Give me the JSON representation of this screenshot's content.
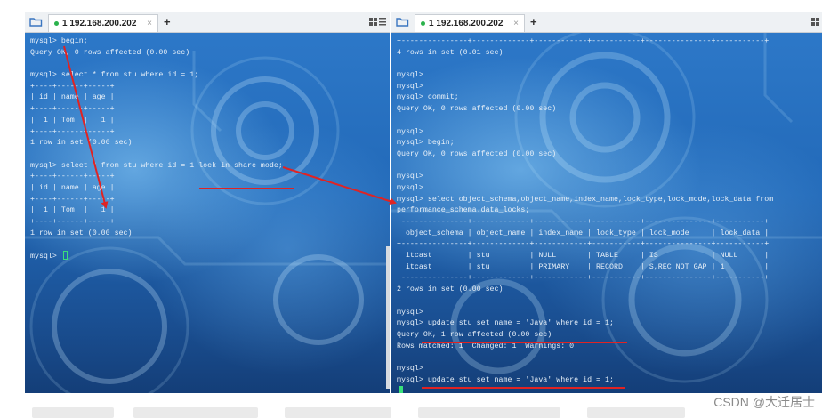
{
  "left": {
    "tab": {
      "label": "1 192.168.200.202",
      "close": "×",
      "add": "+"
    },
    "lines": [
      "mysql> begin;",
      "Query OK, 0 rows affected (0.00 sec)",
      "",
      "mysql> select * from stu where id = 1;",
      "+----+------+-----+",
      "| id | name | age |",
      "+----+------+-----+",
      "|  1 | Tom  |   1 |",
      "+----+------+-----+",
      "1 row in set (0.00 sec)",
      "",
      "mysql> select * from stu where id = 1 lock in share mode;",
      "+----+------+-----+",
      "| id | name | age |",
      "+----+------+-----+",
      "|  1 | Tom  |   1 |",
      "+----+------+-----+",
      "1 row in set (0.00 sec)",
      "",
      "mysql> "
    ]
  },
  "right": {
    "tab": {
      "label": "1 192.168.200.202",
      "close": "×",
      "add": "+"
    },
    "lines": [
      "+---------------+-------------+------------+-----------+---------------+-----------+",
      "4 rows in set (0.01 sec)",
      "",
      "mysql>",
      "mysql>",
      "mysql> commit;",
      "Query OK, 0 rows affected (0.00 sec)",
      "",
      "mysql>",
      "mysql> begin;",
      "Query OK, 0 rows affected (0.00 sec)",
      "",
      "mysql>",
      "mysql>",
      "mysql> select object_schema,object_name,index_name,lock_type,lock_mode,lock_data from",
      "performance_schema.data_locks;",
      "+---------------+-------------+------------+-----------+---------------+-----------+",
      "| object_schema | object_name | index_name | lock_type | lock_mode     | lock_data |",
      "+---------------+-------------+------------+-----------+---------------+-----------+",
      "| itcast        | stu         | NULL       | TABLE     | IS            | NULL      |",
      "| itcast        | stu         | PRIMARY    | RECORD    | S,REC_NOT_GAP | 1         |",
      "+---------------+-------------+------------+-----------+---------------+-----------+",
      "2 rows in set (0.00 sec)",
      "",
      "mysql>",
      "mysql> update stu set name = 'Java' where id = 1;",
      "Query OK, 1 row affected (0.00 sec)",
      "Rows matched: 1  Changed: 1  Warnings: 0",
      "",
      "mysql>",
      "mysql> update stu set name = 'Java' where id = 1;",
      ""
    ]
  },
  "watermark": "CSDN @大迁居士",
  "colors": {
    "terminal_text": "#e6eff8",
    "annotation": "#e02323",
    "cursor": "#39e07a",
    "tab_dot": "#2bb24c"
  },
  "icons": {
    "folder": "folder-icon",
    "grid": "grid-view-icon",
    "list": "list-view-icon"
  }
}
